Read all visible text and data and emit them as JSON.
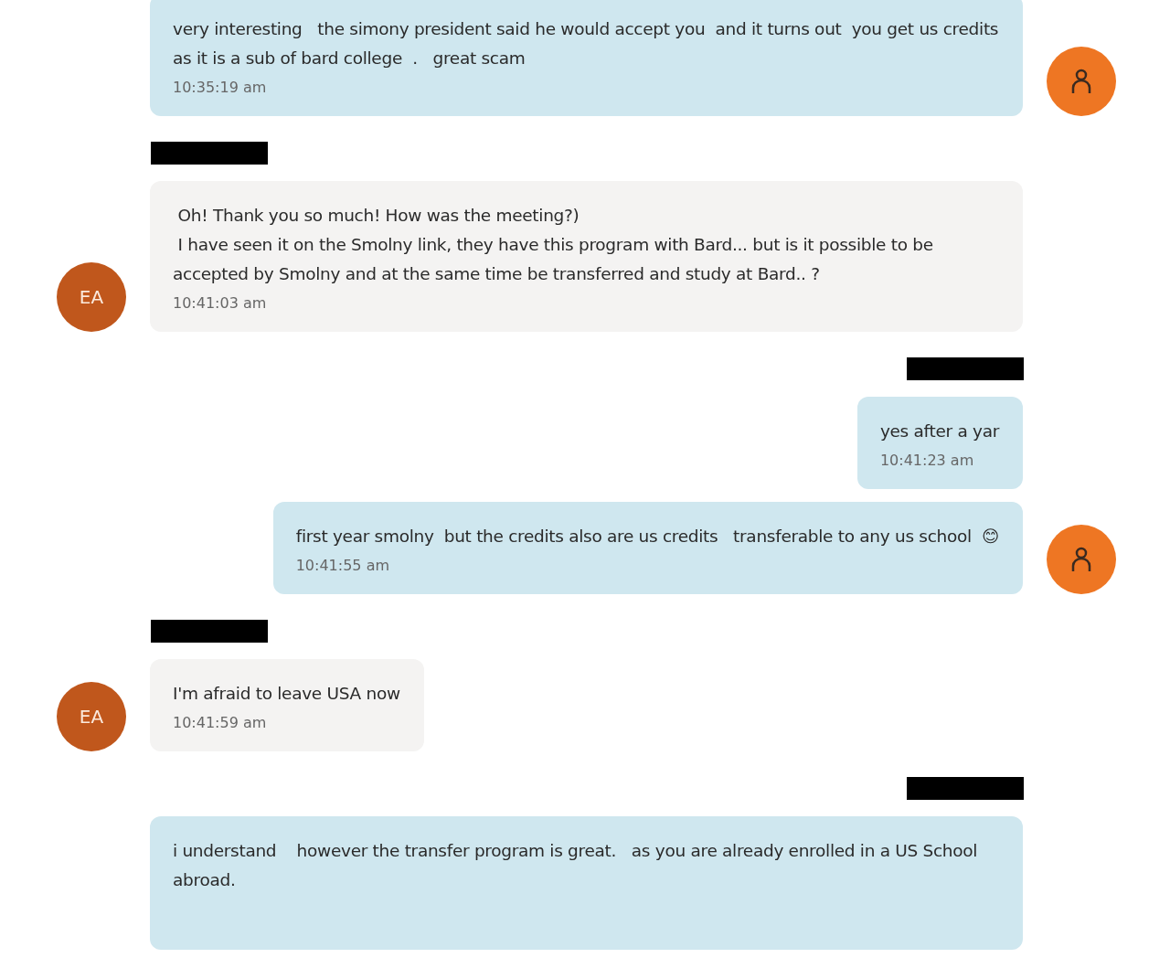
{
  "messages": [
    {
      "kind": "sent",
      "name_redacted": false,
      "avatar": true,
      "text": "very interesting   the simony president said he would accept you  and it turns out  you get us credits  as it is a sub of bard college  .   great scam",
      "time": "10:35:19 am"
    },
    {
      "kind": "received",
      "name_redacted": true,
      "avatar": true,
      "avatar_label": "EA",
      "text": " Oh! Thank you so much! How was the meeting?)\n I have seen it on the Smolny link, they have this program with Bard... but is it possible to be accepted by Smolny and at the same time be transferred and study at Bard.. ?",
      "time": "10:41:03 am"
    },
    {
      "kind": "sent",
      "name_redacted": true,
      "avatar": false,
      "text": "yes after a yar",
      "time": "10:41:23 am"
    },
    {
      "kind": "sent",
      "name_redacted": false,
      "avatar": true,
      "text": "first year smolny  but the credits also are us credits   transferable to any us school  😊",
      "time": "10:41:55 am"
    },
    {
      "kind": "received",
      "name_redacted": true,
      "avatar": true,
      "avatar_label": "EA",
      "text": "I'm afraid to leave USA now",
      "time": "10:41:59 am"
    },
    {
      "kind": "sent",
      "name_redacted": true,
      "avatar": false,
      "text": "i understand    however the transfer program is great.   as you are already enrolled in a US School abroad."
    }
  ]
}
